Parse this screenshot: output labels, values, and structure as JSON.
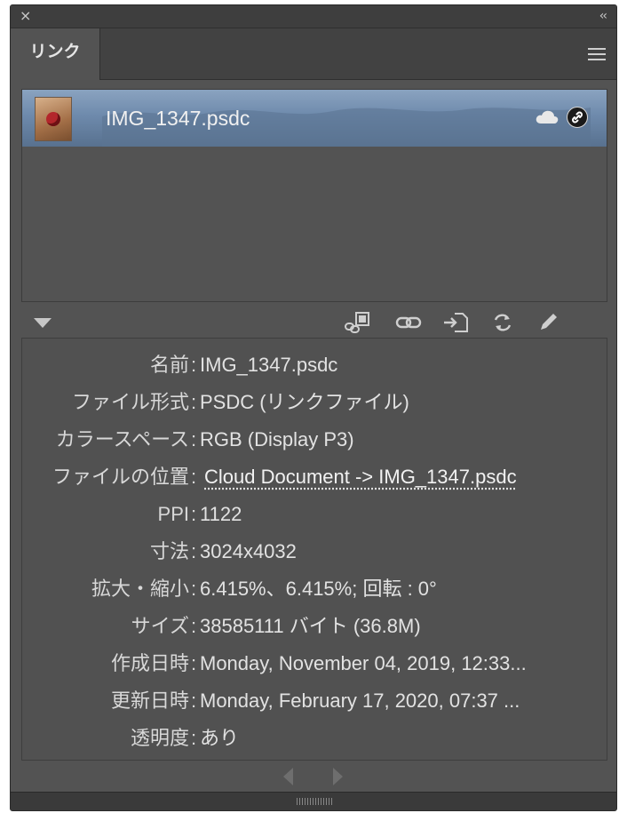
{
  "panel": {
    "close_glyph": "×",
    "collapse_glyph": "‹‹",
    "tab_label": "リンク"
  },
  "links": [
    {
      "file_name": "IMG_1347.psdc",
      "status_icons": [
        "cloud-icon",
        "link-icon"
      ]
    }
  ],
  "toolbar_icons": [
    "relink-from-libraries-icon",
    "relink-icon",
    "go-to-link-icon",
    "update-link-icon",
    "edit-original-icon"
  ],
  "info": {
    "name_label": "名前",
    "name_value": "IMG_1347.psdc",
    "format_label": "ファイル形式",
    "format_value": "PSDC (リンクファイル)",
    "colorspace_label": "カラースペース",
    "colorspace_value": "RGB (Display P3)",
    "location_label": "ファイルの位置",
    "location_value": "Cloud Document -> IMG_1347.psdc",
    "ppi_label": "PPI",
    "ppi_value": "1122",
    "dimensions_label": "寸法",
    "dimensions_value": "3024x4032",
    "scale_label": "拡大・縮小",
    "scale_value": "6.415%、6.415%; 回転 : 0°",
    "size_label": "サイズ",
    "size_value": "38585111 バイト (36.8M)",
    "created_label": "作成日時",
    "created_value": "Monday, November 04, 2019, 12:33...",
    "modified_label": "更新日時",
    "modified_value": "Monday, February 17, 2020, 07:37 ...",
    "transparency_label": "透明度",
    "transparency_value": "あり"
  },
  "colors": {
    "panel_bg": "#535353",
    "selection": "#6e8aac",
    "text": "#e2e2e2"
  }
}
